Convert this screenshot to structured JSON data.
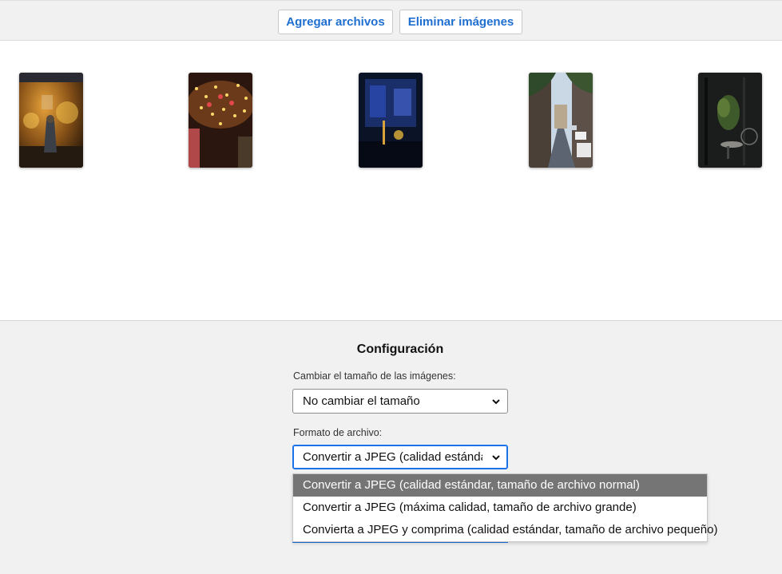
{
  "toolbar": {
    "add_files_label": "Agregar archivos",
    "remove_images_label": "Eliminar imágenes"
  },
  "gallery": {
    "thumbnails": [
      {
        "name": "thumbnail-street-lights-person"
      },
      {
        "name": "thumbnail-hanging-lights"
      },
      {
        "name": "thumbnail-night-blue-window"
      },
      {
        "name": "thumbnail-city-street-cars"
      },
      {
        "name": "thumbnail-dark-terrace-plants"
      }
    ]
  },
  "settings": {
    "title": "Configuración",
    "resize_label": "Cambiar el tamaño de las imágenes:",
    "resize_value": "No cambiar el tamaño",
    "format_label": "Formato de archivo:",
    "format_value": "Convertir a JPEG (calidad estándar, tamaño de archivo normal)",
    "format_options": [
      "Convertir a JPEG (calidad estándar, tamaño de archivo normal)",
      "Convertir a JPEG (máxima calidad, tamaño de archivo grande)",
      "Convierta a JPEG y comprima (calidad estándar, tamaño de archivo pequeño)"
    ],
    "selected_index": 0
  },
  "colors": {
    "accent": "#1f6fd1",
    "focus": "#1a73e8",
    "selected_option_bg": "#757575"
  }
}
